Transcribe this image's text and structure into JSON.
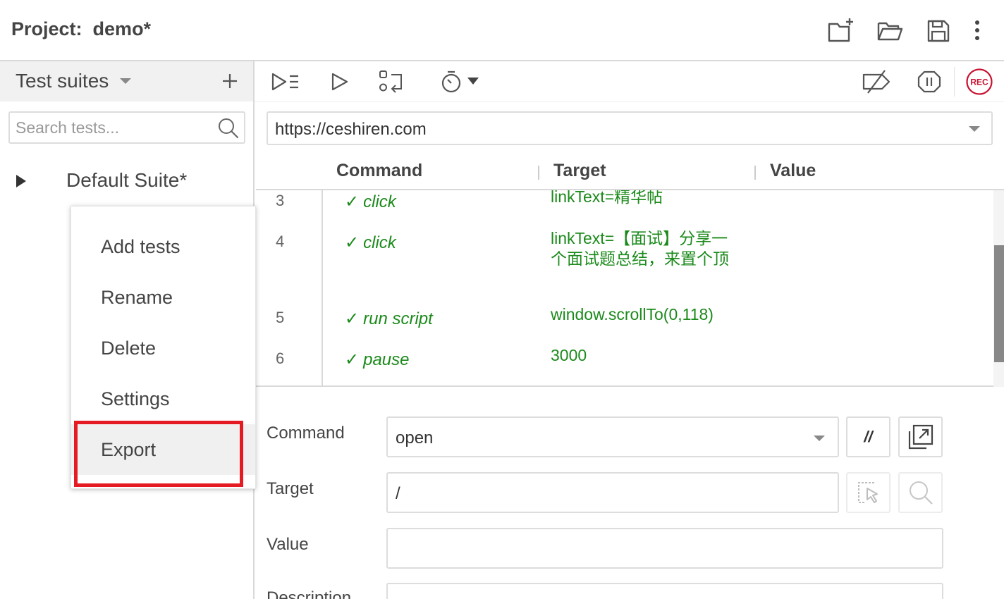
{
  "header": {
    "project_label": "Project:",
    "project_name": "demo*",
    "actions": [
      "new-project-icon",
      "open-project-icon",
      "save-project-icon",
      "more-options-icon"
    ]
  },
  "sidebar": {
    "title": "Test suites",
    "search_placeholder": "Search tests...",
    "suites": [
      {
        "name": "Default Suite*"
      }
    ]
  },
  "context_menu": {
    "items": [
      "Add tests",
      "Rename",
      "Delete",
      "Settings",
      "Export"
    ],
    "highlighted": "Export"
  },
  "toolbar": {
    "buttons": [
      "run-all-tests-icon",
      "run-current-test-icon",
      "step-over-icon",
      "speed-icon",
      "disable-breakpoints-icon",
      "pause-on-exceptions-icon",
      "record-icon"
    ],
    "rec_label": "REC",
    "accent_color": "#c8102e"
  },
  "url": {
    "value": "https://ceshiren.com"
  },
  "table": {
    "headers": {
      "command": "Command",
      "target": "Target",
      "value": "Value"
    },
    "rows": [
      {
        "num": "3",
        "check": "✓",
        "command": "click",
        "target": "linkText=精华帖",
        "value": ""
      },
      {
        "num": "4",
        "check": "✓",
        "command": "click",
        "target": "linkText=【面试】分享一个面试题总结，来置个顶",
        "value": ""
      },
      {
        "num": "5",
        "check": "✓",
        "command": "run script",
        "target": "window.scrollTo(0,118)",
        "value": ""
      },
      {
        "num": "6",
        "check": "✓",
        "command": "pause",
        "target": "3000",
        "value": ""
      }
    ],
    "success_color": "#1b8a1b"
  },
  "editor": {
    "command_label": "Command",
    "command_value": "open",
    "comment_button": "//",
    "target_label": "Target",
    "target_value": "/",
    "value_label": "Value",
    "value_value": "",
    "description_label": "Description"
  }
}
